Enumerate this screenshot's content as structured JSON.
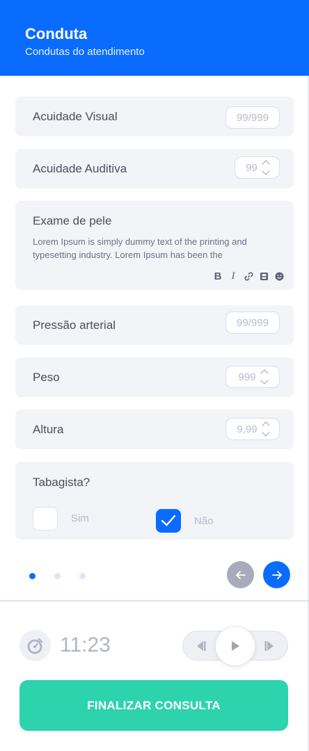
{
  "header": {
    "title": "Conduta",
    "subtitle": "Condutas do atendimento"
  },
  "fields": {
    "acuidade_visual": {
      "label": "Acuidade Visual",
      "placeholder": "99/999"
    },
    "acuidade_auditiva": {
      "label": "Acuidade Auditiva",
      "placeholder": "99"
    },
    "exame_pele": {
      "label": "Exame de pele",
      "text": "Lorem Ipsum is simply dummy text of the printing and typesetting industry. Lorem Ipsum has been the",
      "toolbar": [
        "bold-icon",
        "italic-icon",
        "link-icon",
        "film-icon",
        "emoji-icon"
      ]
    },
    "pressao_arterial": {
      "label": "Pressão arterial",
      "placeholder": "99/999"
    },
    "peso": {
      "label": "Peso",
      "placeholder": "999"
    },
    "altura": {
      "label": "Altura",
      "placeholder": "9,99"
    },
    "tabagista": {
      "label": "Tabagista?",
      "options": [
        {
          "label": "Sim",
          "checked": false
        },
        {
          "label": "Não",
          "checked": true
        }
      ]
    }
  },
  "pagination": {
    "pages": 3,
    "current": 1,
    "active_color": "#0a6cff",
    "inactive_color": "#dfe5f6"
  },
  "nav": {
    "prev_color": "#a9abbb",
    "next_color": "#0a6cff"
  },
  "timer": {
    "value": "11:23"
  },
  "finish_button": {
    "label": "FINALIZAR CONSULTA",
    "color": "#2dd3ad"
  },
  "colors": {
    "primary": "#0a6cff",
    "card_bg": "#f3f4f8"
  }
}
